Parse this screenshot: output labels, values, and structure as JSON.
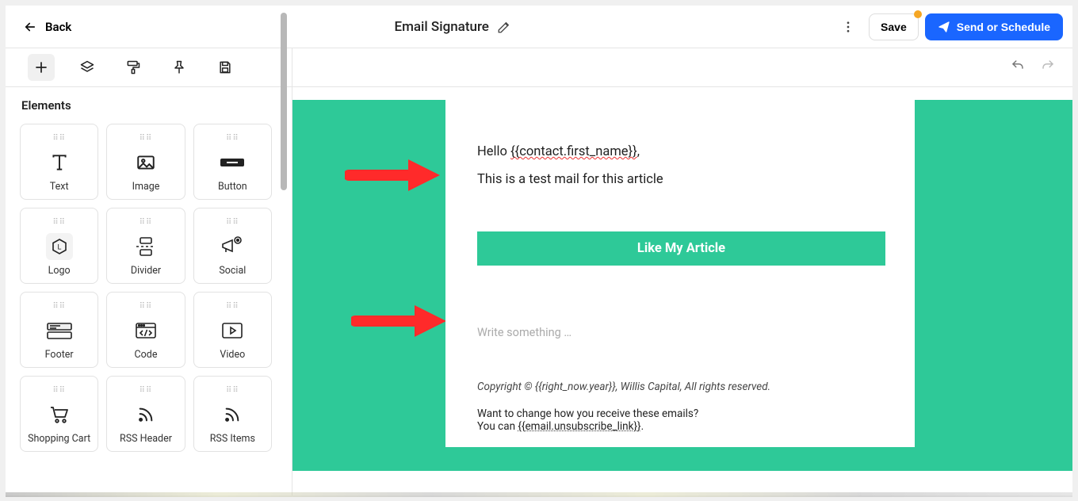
{
  "header": {
    "back_label": "Back",
    "title": "Email Signature",
    "save_label": "Save",
    "send_label": "Send or Schedule"
  },
  "sidebar": {
    "title": "Elements",
    "items": [
      {
        "label": "Text"
      },
      {
        "label": "Image"
      },
      {
        "label": "Button"
      },
      {
        "label": "Logo"
      },
      {
        "label": "Divider"
      },
      {
        "label": "Social"
      },
      {
        "label": "Footer"
      },
      {
        "label": "Code"
      },
      {
        "label": "Video"
      },
      {
        "label": "Shopping Cart"
      },
      {
        "label": "RSS Header"
      },
      {
        "label": "RSS Items"
      }
    ]
  },
  "mail": {
    "greeting_prefix": "Hello ",
    "greeting_tag": "{{contact.first_name}}",
    "greeting_suffix": ",",
    "line2": "This is a test mail for this article",
    "cta": "Like My Article",
    "placeholder": "Write something …",
    "copyright": "Copyright © {{right_now.year}}, Willis Capital, All rights reserved.",
    "unsub_prompt": "Want to change how you receive these emails?",
    "unsub_prefix": "You can ",
    "unsub_link": "{{email.unsubscribe_link}}",
    "unsub_suffix": "."
  },
  "colors": {
    "accent_green": "#2ec998",
    "primary_blue": "#1a66ff",
    "warn_dot": "#f5a623"
  }
}
